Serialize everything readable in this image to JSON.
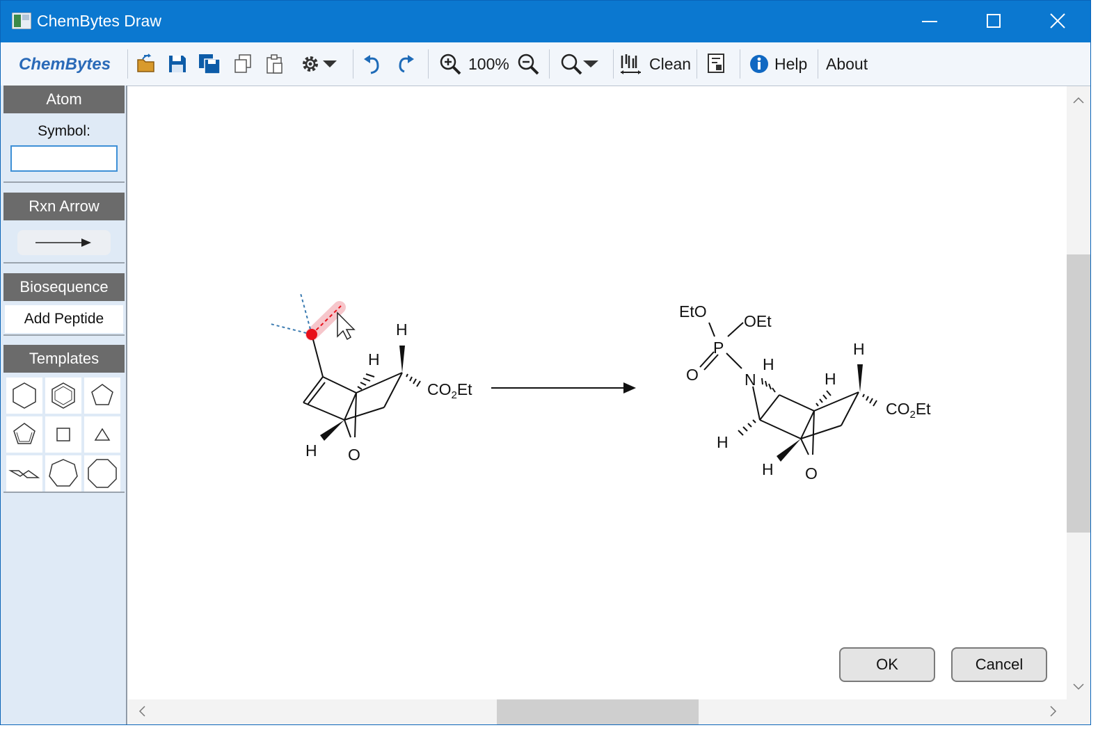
{
  "window": {
    "title": "ChemBytes Draw"
  },
  "toolbar": {
    "brand": "ChemBytes",
    "zoom_level": "100%",
    "clean_label": "Clean",
    "help_label": "Help",
    "about_label": "About",
    "icons": [
      "open-icon",
      "save-icon",
      "save-all-icon",
      "copy-icon",
      "paste-icon",
      "settings-icon",
      "undo-icon",
      "redo-icon",
      "zoom-in-icon",
      "zoom-out-icon",
      "search-icon",
      "clean-icon",
      "report-icon",
      "info-icon"
    ]
  },
  "left_panel": {
    "atom_header": "Atom",
    "symbol_label": "Symbol:",
    "symbol_value": "",
    "rxn_arrow_header": "Rxn Arrow",
    "biosequence_header": "Biosequence",
    "add_peptide_label": "Add Peptide",
    "templates_header": "Templates",
    "templates": [
      "cyclohexane",
      "benzene",
      "cyclopentane",
      "cyclopentadiene",
      "cyclobutane",
      "cyclopropane",
      "chair-cyclohexane",
      "cycloheptane",
      "cyclooctane"
    ]
  },
  "canvas": {
    "reactant_labels": {
      "h_top": "H",
      "h_mid": "H",
      "co2et": "CO",
      "co2et_sub": "2",
      "co2et_tail": "Et",
      "h_left": "H",
      "o_bridge": "O"
    },
    "product_labels": {
      "eto": "EtO",
      "oet": "OEt",
      "p": "P",
      "o": "O",
      "n": "N",
      "h_n": "H",
      "h_top": "H",
      "h_mid": "H",
      "co2et": "CO",
      "co2et_sub": "2",
      "co2et_tail": "Et",
      "h_left": "H",
      "h_bot": "H",
      "o_bridge": "O"
    }
  },
  "dialog": {
    "ok_label": "OK",
    "cancel_label": "Cancel"
  },
  "colors": {
    "titlebar": "#0b78d0",
    "brand": "#2a6ab8",
    "panel": "#dfeaf6",
    "highlight": "#e8101a"
  }
}
